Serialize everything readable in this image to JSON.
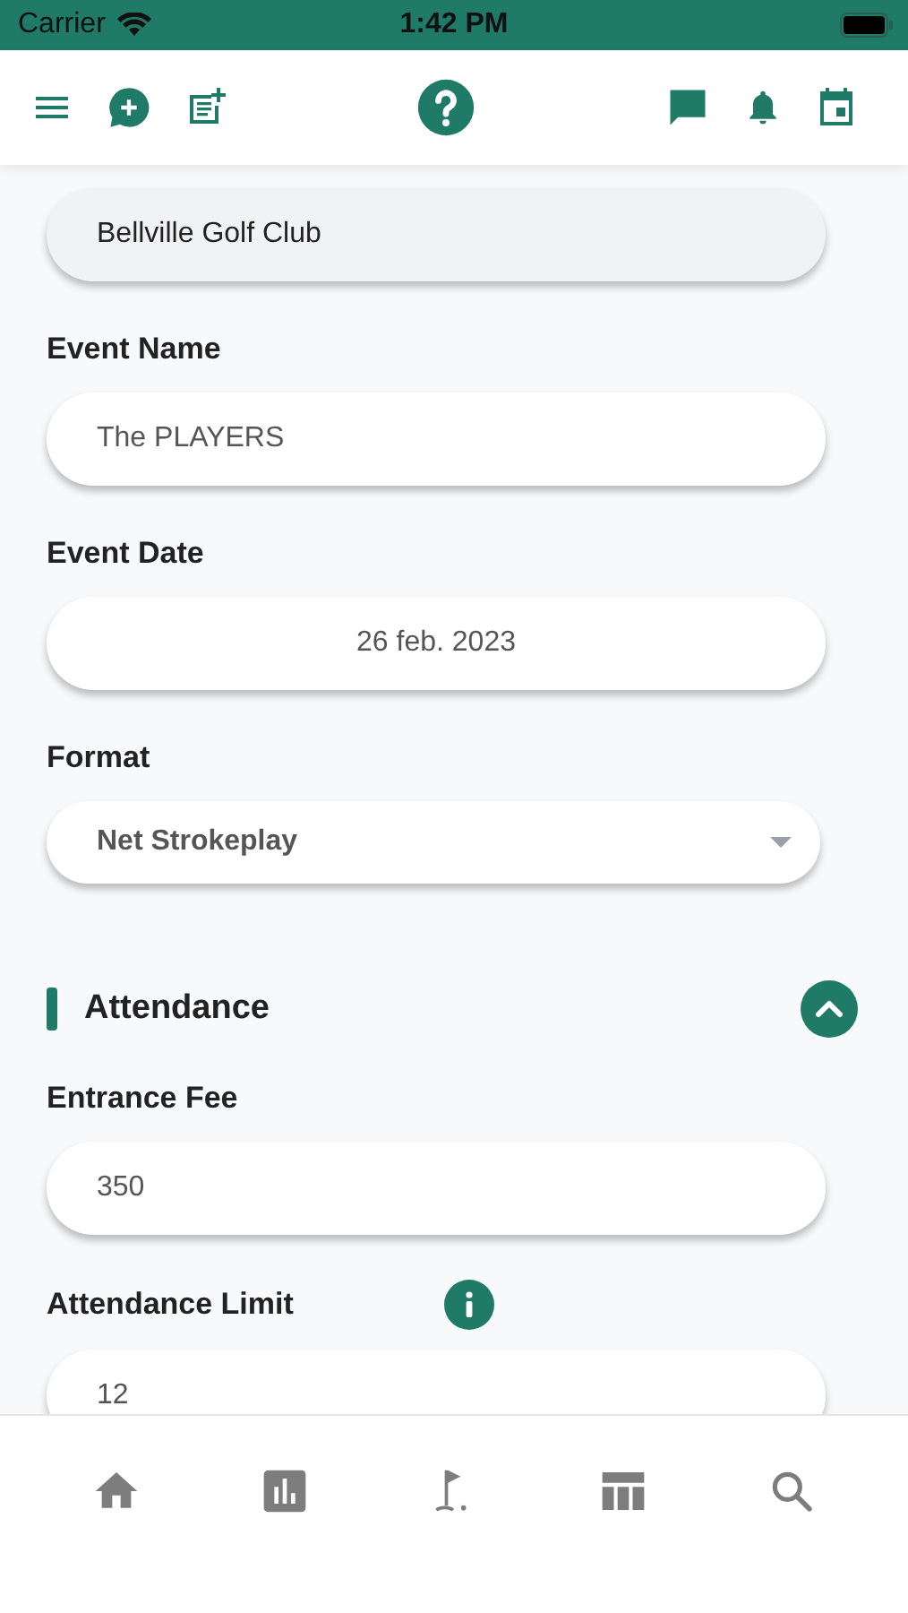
{
  "status_bar": {
    "carrier": "Carrier",
    "time": "1:42 PM"
  },
  "fields": [
    {
      "kind": "text",
      "value": "Bellville Golf Club",
      "disabled": true
    },
    {
      "kind": "text",
      "label": "Event Name",
      "value": "The PLAYERS",
      "disabled": false
    },
    {
      "kind": "date",
      "label": "Event Date",
      "value": "26 feb. 2023",
      "disabled": false
    },
    {
      "kind": "select",
      "label": "Format",
      "value": "Net Strokeplay",
      "disabled": false
    }
  ],
  "section": {
    "title": "Attendance",
    "expanded": true,
    "fields": [
      {
        "kind": "text",
        "label": "Entrance Fee",
        "value": "350",
        "disabled": false
      },
      {
        "kind": "text",
        "label": "Attendance Limit",
        "value": "12",
        "disabled": false,
        "info": true
      }
    ]
  }
}
